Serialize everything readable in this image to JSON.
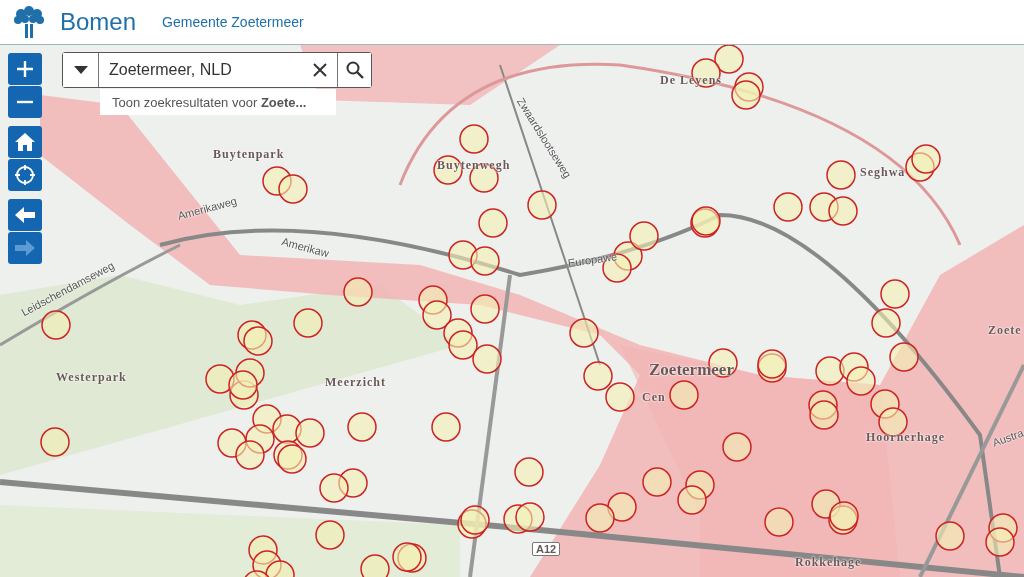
{
  "header": {
    "title": "Bomen",
    "subtitle": "Gemeente Zoetermeer"
  },
  "search": {
    "value": "Zoetermeer, NLD",
    "suggestion": "Toon zoekresultaten voor **Zoete...**"
  },
  "map_controls": [
    {
      "kind": "zoom-in",
      "disabled": false
    },
    {
      "kind": "zoom-out",
      "disabled": false
    },
    {
      "kind": "home",
      "disabled": false
    },
    {
      "kind": "locate",
      "disabled": false
    },
    {
      "kind": "back",
      "disabled": false
    },
    {
      "kind": "forward",
      "disabled": true
    }
  ],
  "map_labels": [
    {
      "text": "Buytenpark",
      "kind": "district"
    },
    {
      "text": "Buytenwegh",
      "kind": "district"
    },
    {
      "text": "De Leyens",
      "kind": "district"
    },
    {
      "text": "Seghwa",
      "kind": "district"
    },
    {
      "text": "Zwaardslootseweg",
      "kind": "road"
    },
    {
      "text": "Amerikaweg",
      "kind": "road"
    },
    {
      "text": "Amerikaw",
      "kind": "road"
    },
    {
      "text": "Europawe",
      "kind": "road"
    },
    {
      "text": "Leidschendamseweg",
      "kind": "road"
    },
    {
      "text": "Westerpark",
      "kind": "district"
    },
    {
      "text": "Meerzicht",
      "kind": "district"
    },
    {
      "text": "Zoetermeer",
      "kind": "city"
    },
    {
      "text": "Cen",
      "kind": "district"
    },
    {
      "text": "Hoornerhage",
      "kind": "district"
    },
    {
      "text": "Rokkehage",
      "kind": "district"
    },
    {
      "text": "Zoete",
      "kind": "district"
    },
    {
      "text": "Austra",
      "kind": "road"
    },
    {
      "text": "A12",
      "kind": "highway"
    }
  ]
}
